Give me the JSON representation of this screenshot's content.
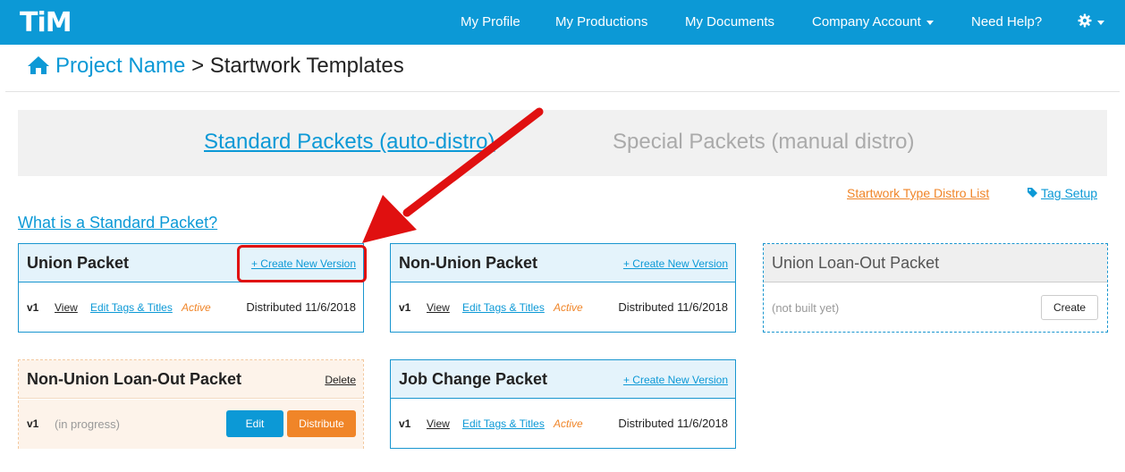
{
  "navbar": {
    "logo": "TiM",
    "items": [
      "My Profile",
      "My Productions",
      "My Documents",
      "Company Account",
      "Need Help?"
    ],
    "settings_icon": "gear-icon",
    "color": "#0c99d6"
  },
  "breadcrumb": {
    "home_icon": "home-icon",
    "project": "Project Name",
    "separator": ">",
    "current": "Startwork Templates"
  },
  "tabs": {
    "active": "Standard Packets (auto-distro)",
    "inactive": "Special Packets (manual distro)"
  },
  "links": {
    "distro_list": "Startwork Type Distro List",
    "tag_setup": "Tag Setup",
    "tag_icon": "tag-icon",
    "what_is": "What is a Standard Packet?"
  },
  "cards": {
    "union": {
      "title": "Union Packet",
      "action": "+ Create New Version",
      "version": "v1",
      "view": "View",
      "edit": "Edit Tags & Titles",
      "status": "Active",
      "distributed": "Distributed 11/6/2018"
    },
    "nonunion": {
      "title": "Non-Union Packet",
      "action": "+ Create New Version",
      "version": "v1",
      "view": "View",
      "edit": "Edit Tags & Titles",
      "status": "Active",
      "distributed": "Distributed 11/6/2018"
    },
    "union_loanout": {
      "title": "Union Loan-Out Packet",
      "note": "(not built yet)",
      "button": "Create"
    },
    "nonunion_loanout": {
      "title": "Non-Union Loan-Out Packet",
      "action": "Delete",
      "version": "v1",
      "note": "(in progress)",
      "edit_button": "Edit",
      "distribute_button": "Distribute"
    },
    "job_change": {
      "title": "Job Change Packet",
      "action": "+ Create New Version",
      "version": "v1",
      "view": "View",
      "edit": "Edit Tags & Titles",
      "status": "Active",
      "distributed": "Distributed 11/6/2018"
    }
  },
  "colors": {
    "accent": "#0c99d6",
    "orange": "#f08528",
    "annotation": "#e01010"
  }
}
